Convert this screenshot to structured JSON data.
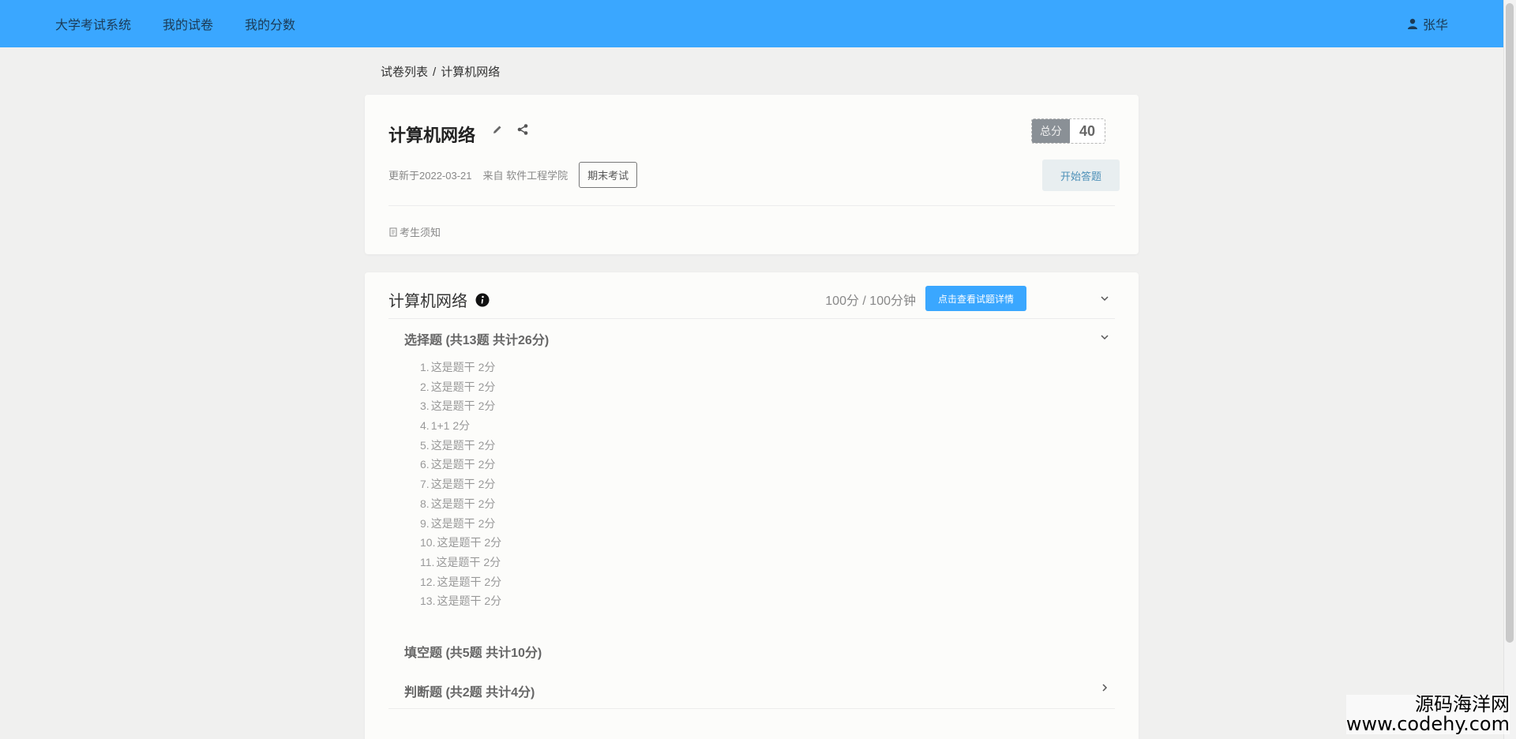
{
  "nav": {
    "brand": "大学考试系统",
    "items": [
      "我的试卷",
      "我的分数"
    ],
    "user": "张华"
  },
  "breadcrumb": {
    "root": "试卷列表",
    "sep": "/",
    "current": "计算机网络"
  },
  "paper": {
    "title": "计算机网络",
    "score_label": "总分",
    "score_value": "40",
    "updated": "更新于2022-03-21",
    "source": "来自 软件工程学院",
    "tag": "期末考试",
    "start_label": "开始答题",
    "notice_label": "考生须知"
  },
  "section": {
    "title": "计算机网络",
    "duration": "100分 / 100分钟",
    "detail_label": "点击查看试题详情",
    "groups": [
      {
        "title": "选择题 (共13题 共计26分)",
        "expanded": true,
        "questions": [
          {
            "num": "1.",
            "text": "这是题干 2分"
          },
          {
            "num": "2.",
            "text": "这是题干 2分"
          },
          {
            "num": "3.",
            "text": "这是题干 2分"
          },
          {
            "num": "4.",
            "text": "1+1 2分"
          },
          {
            "num": "5.",
            "text": "这是题干 2分"
          },
          {
            "num": "6.",
            "text": "这是题干 2分"
          },
          {
            "num": "7.",
            "text": "这是题干 2分"
          },
          {
            "num": "8.",
            "text": "这是题干 2分"
          },
          {
            "num": "9.",
            "text": "这是题干 2分"
          },
          {
            "num": "10.",
            "text": "这是题干 2分"
          },
          {
            "num": "11.",
            "text": "这是题干 2分"
          },
          {
            "num": "12.",
            "text": "这是题干 2分"
          },
          {
            "num": "13.",
            "text": "这是题干 2分"
          }
        ]
      },
      {
        "title": "填空题 (共5题 共计10分)",
        "expanded": false
      },
      {
        "title": "判断题 (共2题 共计4分)",
        "expanded": false
      }
    ]
  },
  "watermark": {
    "cn": "源码海洋网",
    "en": "www.codehy.com"
  },
  "colors": {
    "topbar": "#3aa7ff",
    "accent_button": "#3aa7ff",
    "page_bg": "#f0f0ef"
  },
  "icons": [
    "user-icon",
    "edit-icon",
    "share-icon",
    "document-icon",
    "info-icon",
    "chevron-down-icon",
    "chevron-right-icon"
  ]
}
